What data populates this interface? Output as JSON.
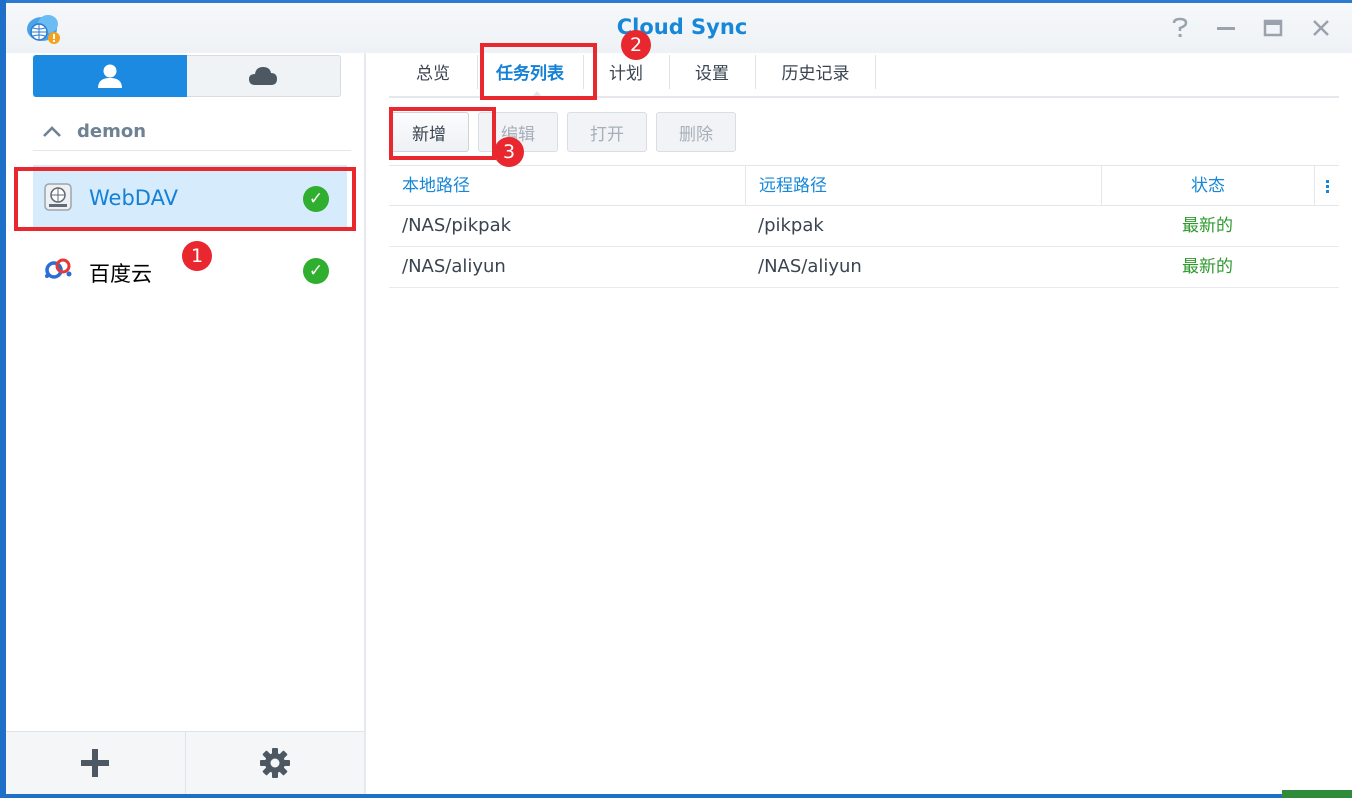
{
  "window": {
    "title": "Cloud Sync",
    "controls": {
      "help": "?",
      "minimize": "—",
      "maximize": "▭",
      "close": "✕"
    }
  },
  "sidebar": {
    "group": "demon",
    "connections": [
      {
        "label": "WebDAV",
        "selected": true,
        "status": "ok"
      },
      {
        "label": "百度云",
        "selected": false,
        "status": "ok"
      }
    ],
    "bottom": {
      "add_icon": "plus-icon",
      "settings_icon": "gear-icon"
    }
  },
  "tabs": [
    {
      "label": "总览"
    },
    {
      "label": "任务列表",
      "active": true
    },
    {
      "label": "计划"
    },
    {
      "label": "设置"
    },
    {
      "label": "历史记录"
    }
  ],
  "toolbar": {
    "add": "新增",
    "edit": "编辑",
    "open": "打开",
    "delete": "删除"
  },
  "task_table": {
    "columns": [
      "本地路径",
      "远程路径",
      "状态"
    ],
    "rows": [
      {
        "local": "/NAS/pikpak",
        "remote": "/pikpak",
        "status": "最新的"
      },
      {
        "local": "/NAS/aliyun",
        "remote": "/NAS/aliyun",
        "status": "最新的"
      }
    ]
  },
  "annotations": [
    "1",
    "2",
    "3"
  ],
  "colors": {
    "accent": "#1787d8",
    "selected_bg": "#d6ebfb",
    "status_ok": "#2fae2f",
    "annotation_red": "#e8282e"
  }
}
